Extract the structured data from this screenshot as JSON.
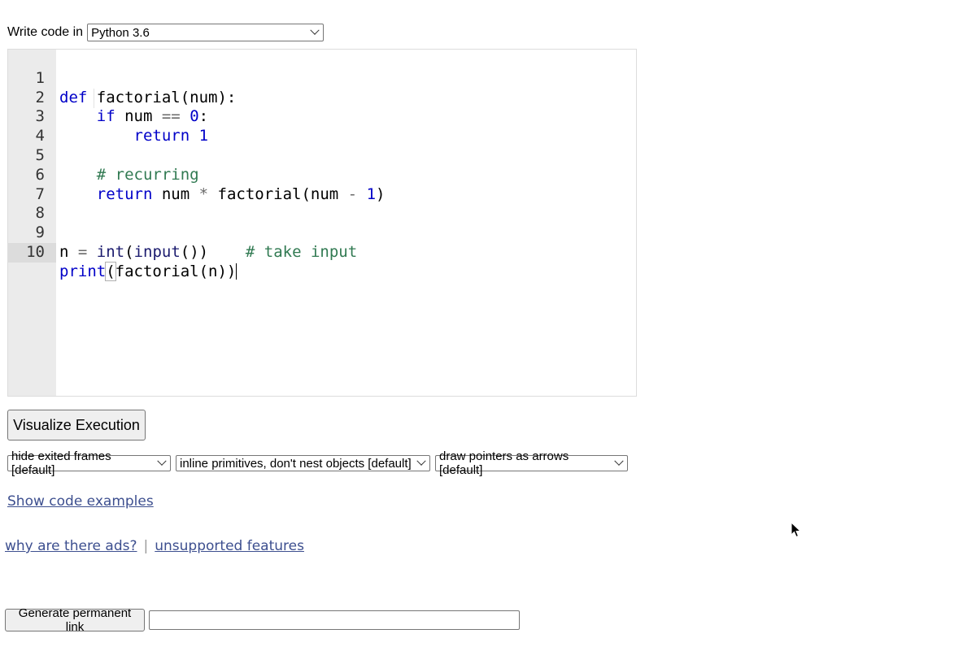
{
  "language": {
    "label": "Write code in",
    "selected": "Python 3.6"
  },
  "editor": {
    "active_line": 10,
    "lines": [
      {
        "n": "1"
      },
      {
        "n": "2"
      },
      {
        "n": "3"
      },
      {
        "n": "4"
      },
      {
        "n": "5"
      },
      {
        "n": "6"
      },
      {
        "n": "7"
      },
      {
        "n": "8"
      },
      {
        "n": "9"
      },
      {
        "n": "10"
      }
    ],
    "code": {
      "l1_kw": "def",
      "l1_rest": " factorial(num):",
      "l2_indent": "    ",
      "l2_kw": "if",
      "l2_a": " num ",
      "l2_op": "==",
      "l2_sp": " ",
      "l2_num": "0",
      "l2_end": ":",
      "l3_indent": "        ",
      "l3_kw": "return",
      "l3_sp": " ",
      "l3_num": "1",
      "l5_indent": "    ",
      "l5_cmt": "# recurring",
      "l6_indent": "    ",
      "l6_kw": "return",
      "l6_a": " num ",
      "l6_op": "*",
      "l6_b": " factorial(num ",
      "l6_op2": "-",
      "l6_sp": " ",
      "l6_num": "1",
      "l6_end": ")",
      "l9_a": "n ",
      "l9_op": "=",
      "l9_sp": " ",
      "l9_bi1": "int",
      "l9_p1": "(",
      "l9_bi2": "input",
      "l9_p2": "())",
      "l9_gap": "    ",
      "l9_cmt": "# take input",
      "l10_bi": "print",
      "l10_paren": "(",
      "l10_rest": "factorial(n))"
    }
  },
  "buttons": {
    "visualize": "Visualize Execution",
    "permalink": "Generate permanent link"
  },
  "options": {
    "frames": "hide exited frames [default]",
    "primitives": "inline primitives, don't nest objects [default]",
    "pointers": "draw pointers as arrows [default]"
  },
  "links": {
    "show_examples": "Show code examples",
    "why_ads": "why are there ads?",
    "separator": "|",
    "unsupported": "unsupported features"
  },
  "permalink_input": {
    "value": ""
  },
  "colors": {
    "keyword": "#0000c8",
    "comment": "#317a52",
    "link": "#3d4f8f",
    "gutter": "#ebebeb"
  }
}
